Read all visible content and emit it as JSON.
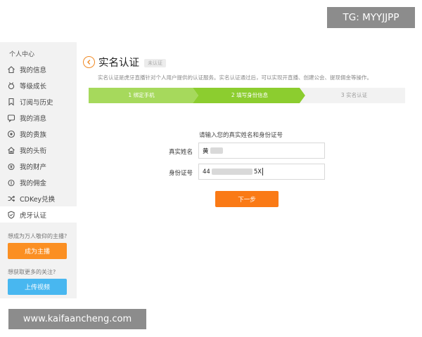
{
  "sidebar": {
    "heading": "个人中心",
    "items": [
      {
        "label": "我的信息",
        "icon": "home-icon"
      },
      {
        "label": "等级成长",
        "icon": "medal-icon"
      },
      {
        "label": "订阅与历史",
        "icon": "bookmark-icon"
      },
      {
        "label": "我的消息",
        "icon": "message-icon"
      },
      {
        "label": "我的贵族",
        "icon": "badge-icon"
      },
      {
        "label": "我的头衔",
        "icon": "house-title-icon"
      },
      {
        "label": "我的财产",
        "icon": "wallet-icon"
      },
      {
        "label": "我的佣金",
        "icon": "coins-icon"
      },
      {
        "label": "CDKey兑换",
        "icon": "shuffle-icon"
      },
      {
        "label": "虎牙认证",
        "icon": "shield-check-icon",
        "active": true
      }
    ],
    "promo1_question": "想成为万人敬仰的主播?",
    "promo1_button": "成为主播",
    "promo2_question": "想获取更多的关注?",
    "promo2_button": "上传视频"
  },
  "header": {
    "title": "实名认证",
    "status": "未认证",
    "description": "实名认证是虎牙直播针对个人用户提供的认证服务。实名认证通过后，可以实现开直播、创建公会、提现佣金等操作。"
  },
  "steps": [
    {
      "label": "1 绑定手机",
      "state": "done"
    },
    {
      "label": "2 填写身份信息",
      "state": "current"
    },
    {
      "label": "3 实名认证",
      "state": "pending"
    }
  ],
  "form": {
    "title": "请输入您的真实姓名和身份证号",
    "name_label": "真实姓名",
    "name_value": "黄",
    "id_label": "身份证号",
    "id_prefix": "44",
    "id_suffix": "5X",
    "submit_label": "下一步"
  },
  "colors": {
    "accent_orange": "#fa7a16",
    "step_green_light": "#a6d95c",
    "step_green": "#8ccd2f",
    "step_pending": "#f2f2f2",
    "upload_blue": "#48b7f0"
  },
  "watermarks": {
    "top": "TG: MYYJJPP",
    "bottom": "www.kaifaancheng.com"
  }
}
